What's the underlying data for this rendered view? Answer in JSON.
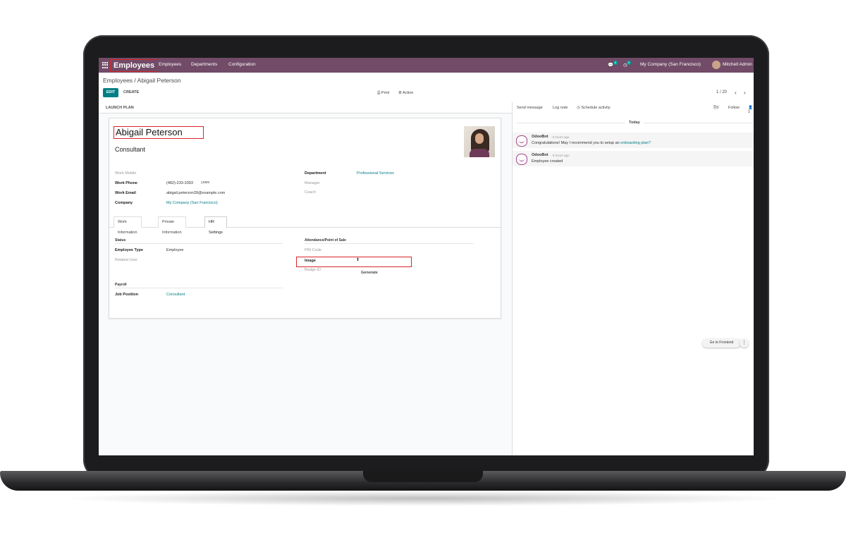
{
  "navbar": {
    "app_title": "Employees",
    "menu": [
      "Employees",
      "Departments",
      "Configuration"
    ],
    "messages_count": "8",
    "activities_count": "3",
    "company": "My Company (San Francisco)",
    "user": "Mitchell Admin",
    "color": "#714b67"
  },
  "control": {
    "breadcrumb": "Employees / Abigail Peterson",
    "edit_label": "EDIT",
    "create_label": "CREATE",
    "print_label": "⎙ Print",
    "action_label": "⚙ Action",
    "pager": "1 / 20"
  },
  "statusbar": {
    "launch_plan": "LAUNCH PLAN"
  },
  "employee": {
    "name": "Abigail Peterson",
    "job_title": "Consultant",
    "fields_left": {
      "work_mobile_label": "Work Mobile",
      "work_phone_label": "Work Phone",
      "work_phone": "(482)-233-3393",
      "sms_label": "SMS",
      "work_email_label": "Work Email",
      "work_email": "abigail.peterson39@example.com",
      "company_label": "Company",
      "company": "My Company (San Francisco)"
    },
    "fields_right": {
      "department_label": "Department",
      "department": "Professional Services",
      "manager_label": "Manager",
      "coach_label": "Coach"
    }
  },
  "tabs": [
    "Work Information",
    "Private Information",
    "HR Settings"
  ],
  "hr_settings": {
    "status_title": "Status",
    "employee_type_label": "Employee Type",
    "employee_type": "Employee",
    "related_user_label": "Related User",
    "payroll_title": "Payroll",
    "job_position_label": "Job Position",
    "job_position": "Consultant",
    "attendance_title": "Attendance/Point of Sale",
    "pin_code_label": "PIN Code",
    "image_label": "Image",
    "badge_id_label": "Badge ID",
    "generate_label": "Generate"
  },
  "chatter": {
    "send_message": "Send message",
    "log_note": "Log note",
    "schedule_activity": "◷ Schedule activity",
    "attachments": "0",
    "follow": "Follow",
    "followers": "1",
    "today": "Today",
    "messages": [
      {
        "author": "OdooBot",
        "time": "- 6 hours ago",
        "body": "Congratulations! May I recommend you to setup an ",
        "link": "onboarding plan?"
      },
      {
        "author": "OdooBot",
        "time": "- 6 hours ago",
        "body": "Employee created",
        "link": ""
      }
    ],
    "go_frontend": "Go to Frontend"
  }
}
